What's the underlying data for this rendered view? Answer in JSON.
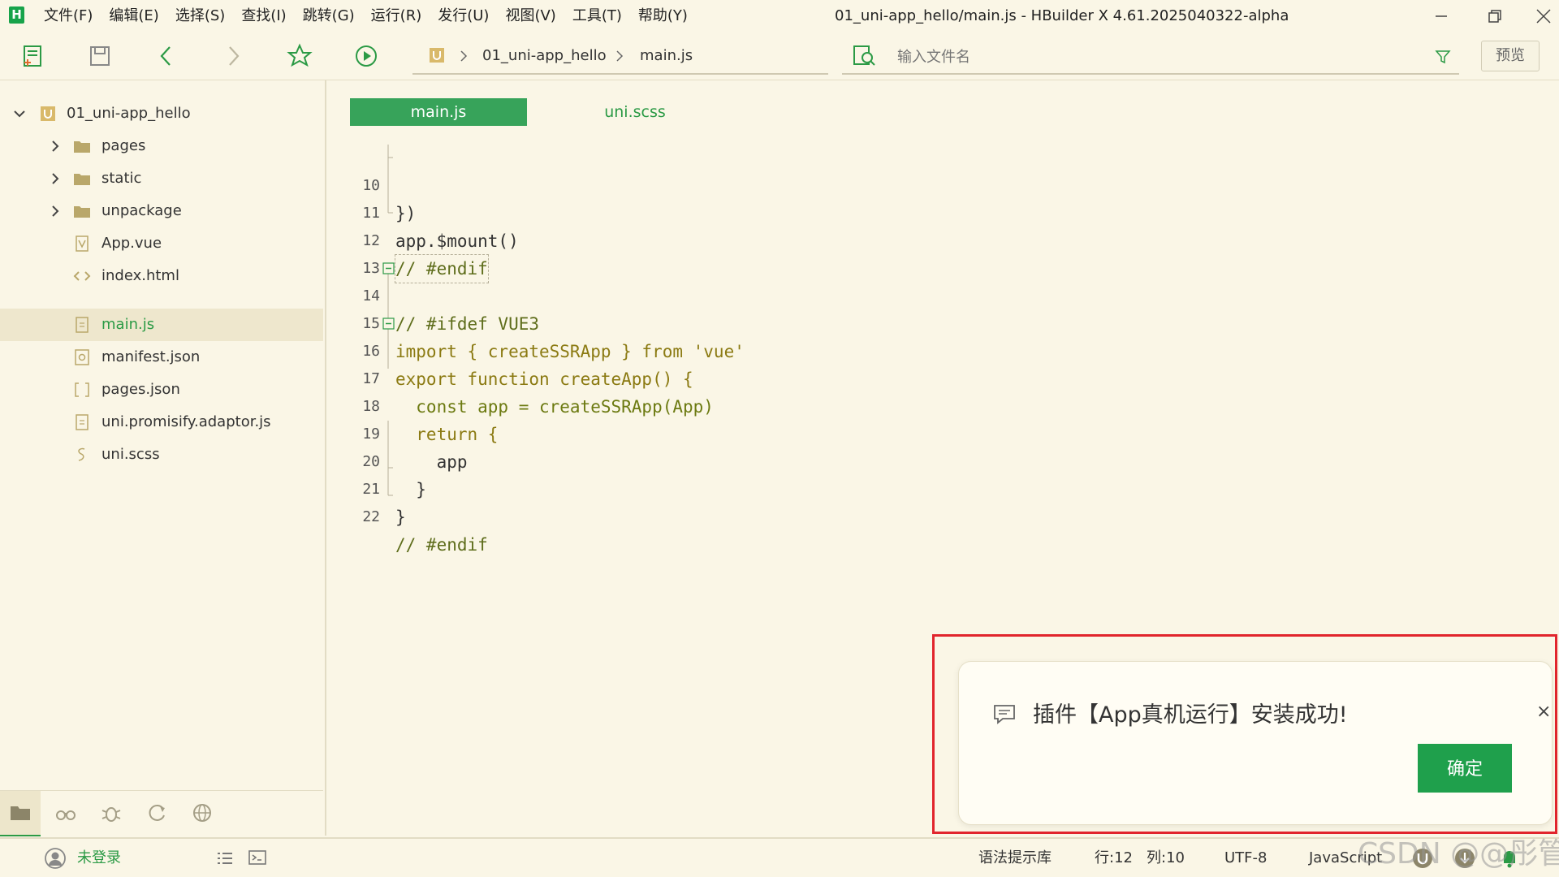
{
  "app": {
    "logo": "H",
    "window_title": "01_uni-app_hello/main.js - HBuilder X 4.61.2025040322-alpha"
  },
  "menu": [
    "文件(F)",
    "编辑(E)",
    "选择(S)",
    "查找(I)",
    "跳转(G)",
    "运行(R)",
    "发行(U)",
    "视图(V)",
    "工具(T)",
    "帮助(Y)"
  ],
  "toolbar": {
    "breadcrumb": [
      "01_uni-app_hello",
      "main.js"
    ],
    "file_search_placeholder": "输入文件名",
    "preview_label": "预览"
  },
  "sidebar": {
    "project": "01_uni-app_hello",
    "items": [
      {
        "label": "pages",
        "type": "folder"
      },
      {
        "label": "static",
        "type": "folder"
      },
      {
        "label": "unpackage",
        "type": "folder"
      },
      {
        "label": "App.vue",
        "type": "vue-file"
      },
      {
        "label": "index.html",
        "type": "html-file"
      },
      {
        "label": "main.js",
        "type": "js-file",
        "selected": true
      },
      {
        "label": "manifest.json",
        "type": "manifest-file"
      },
      {
        "label": "pages.json",
        "type": "json-file"
      },
      {
        "label": "uni.promisify.adaptor.js",
        "type": "js-file"
      },
      {
        "label": "uni.scss",
        "type": "scss-file"
      }
    ]
  },
  "editor": {
    "tabs": [
      {
        "label": "main.js",
        "active": true
      },
      {
        "label": "uni.scss",
        "active": false
      }
    ],
    "lines": [
      {
        "num": "10",
        "code": "})"
      },
      {
        "num": "11",
        "code": "app.$mount()"
      },
      {
        "num": "12",
        "code": "// #endif"
      },
      {
        "num": "13",
        "code": ""
      },
      {
        "num": "14",
        "code": "// #ifdef VUE3"
      },
      {
        "num": "15",
        "code": "import { createSSRApp } from 'vue'"
      },
      {
        "num": "16",
        "code": "export function createApp() {"
      },
      {
        "num": "17",
        "code": "  const app = createSSRApp(App)"
      },
      {
        "num": "18",
        "code": "  return {"
      },
      {
        "num": "19",
        "code": "    app"
      },
      {
        "num": "20",
        "code": "  }"
      },
      {
        "num": "21",
        "code": "}"
      },
      {
        "num": "22",
        "code": "// #endif"
      }
    ]
  },
  "notification": {
    "message": "插件【App真机运行】安装成功!",
    "ok_label": "确定",
    "close_symbol": "×"
  },
  "statusbar": {
    "login": "未登录",
    "syntax_lib": "语法提示库",
    "row": "行:12",
    "col": "列:10",
    "encoding": "UTF-8",
    "language": "JavaScript"
  },
  "watermark": "CSDN @@彤管",
  "colors": {
    "background": "#FAF6E6",
    "accent_green": "#37A35A",
    "highlight_red": "#E1252D"
  }
}
